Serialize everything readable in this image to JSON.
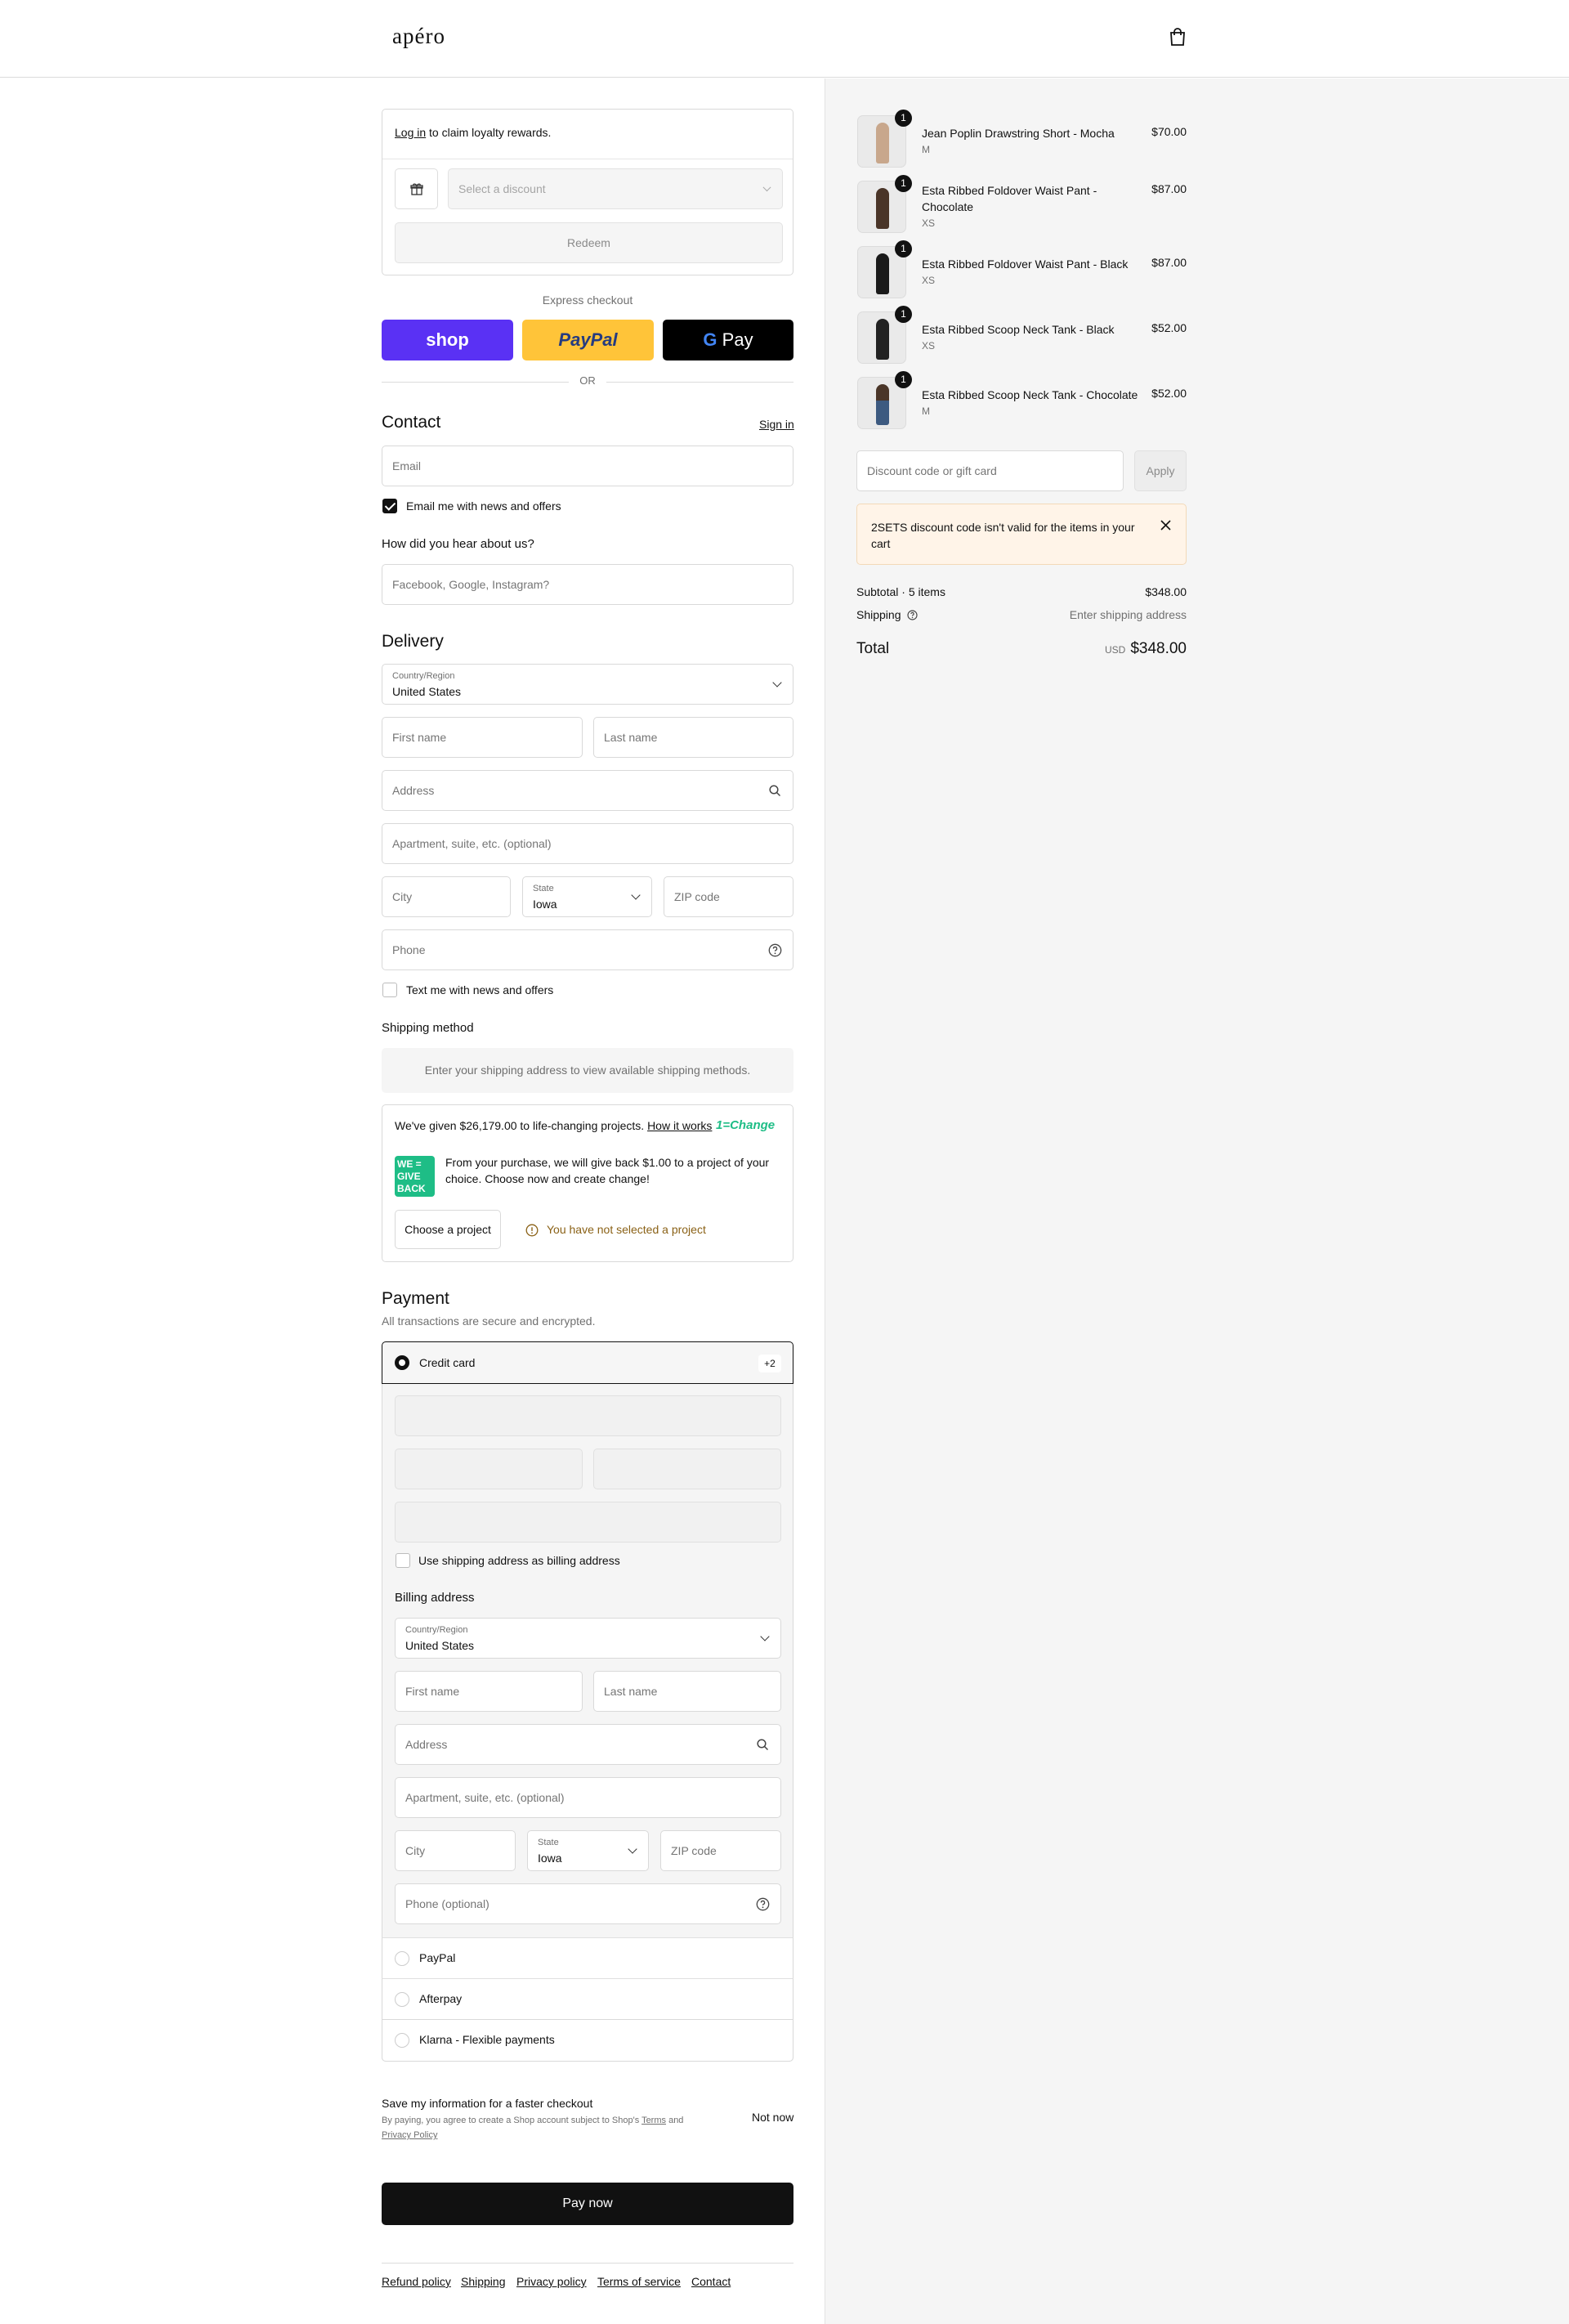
{
  "brand": "apéro",
  "loyalty": {
    "login_link": "Log in",
    "rest": " to claim loyalty rewards.",
    "select_placeholder": "Select a discount",
    "redeem": "Redeem"
  },
  "express": {
    "title": "Express checkout",
    "shop": "shop",
    "paypal": "PayPal",
    "gpay": "Pay",
    "or": "OR"
  },
  "contact": {
    "title": "Contact",
    "signin": "Sign in",
    "email_ph": "Email",
    "news": "Email me with news and offers",
    "hear_title": "How did you hear about us?",
    "hear_ph": "Facebook, Google, Instagram?"
  },
  "delivery": {
    "title": "Delivery",
    "country_label": "Country/Region",
    "country": "United States",
    "first": "First name",
    "last": "Last name",
    "address": "Address",
    "apt": "Apartment, suite, etc. (optional)",
    "city": "City",
    "state_label": "State",
    "state": "Iowa",
    "zip": "ZIP code",
    "phone": "Phone",
    "text_news": "Text me with news and offers"
  },
  "shipping": {
    "title": "Shipping method",
    "msg": "Enter your shipping address to view available shipping methods."
  },
  "change": {
    "given": "We've given $26,179.00 to life-changing projects.",
    "how": "How it works",
    "brand": "1=Change",
    "logo": [
      "WE =",
      "GIVE",
      "BACK"
    ],
    "line1": "From your purchase, we will give back $1.00 to a project of your",
    "line2": "choice. Choose now and create change!",
    "choose": "Choose a project",
    "warning": "You have not selected a project"
  },
  "payment": {
    "title": "Payment",
    "sub": "All transactions are secure and encrypted.",
    "credit": "Credit card",
    "more": "+2",
    "use_shipping": "Use shipping address as billing address",
    "billing_title": "Billing address",
    "country_label": "Country/Region",
    "country": "United States",
    "first": "First name",
    "last": "Last name",
    "address": "Address",
    "apt": "Apartment, suite, etc. (optional)",
    "city": "City",
    "state_label": "State",
    "state": "Iowa",
    "zip": "ZIP code",
    "phone": "Phone (optional)",
    "options": [
      "PayPal",
      "Afterpay",
      "Klarna - Flexible payments"
    ]
  },
  "save": {
    "title": "Save my information for a faster checkout",
    "legal1": "By paying, you agree to create a Shop account subject to Shop's ",
    "terms": "Terms",
    "and": " and",
    "privacy": "Privacy Policy",
    "not_now": "Not now"
  },
  "pay_now": "Pay now",
  "footer": [
    "Refund policy",
    "Shipping",
    "Privacy policy",
    "Terms of service",
    "Contact"
  ],
  "cart": {
    "items": [
      {
        "name": "Jean Poplin Drawstring Short - Mocha",
        "variant": "M",
        "price": "$70.00",
        "qty": "1"
      },
      {
        "name": "Esta Ribbed Foldover Waist Pant -",
        "name2": "Chocolate",
        "variant": "XS",
        "price": "$87.00",
        "qty": "1"
      },
      {
        "name": "Esta Ribbed Foldover Waist Pant - Black",
        "variant": "XS",
        "price": "$87.00",
        "qty": "1"
      },
      {
        "name": "Esta Ribbed Scoop Neck Tank - Black",
        "variant": "XS",
        "price": "$52.00",
        "qty": "1"
      },
      {
        "name": "Esta Ribbed Scoop Neck Tank - Chocolate",
        "variant": "M",
        "price": "$52.00",
        "qty": "1"
      }
    ],
    "discount_ph": "Discount code or gift card",
    "apply": "Apply",
    "error1": "2SETS discount code isn't valid for the items in your",
    "error2": "cart",
    "subtotal_label": "Subtotal · 5 items",
    "subtotal": "$348.00",
    "shipping_label": "Shipping",
    "shipping_val": "Enter shipping address",
    "total_label": "Total",
    "currency": "USD",
    "total": "$348.00"
  },
  "colors": {
    "shop": "#5a31f4",
    "paypal": "#ffc439",
    "change_green": "#1ebd86",
    "warn": "#8a6116",
    "error_bg": "#fff4e8"
  }
}
